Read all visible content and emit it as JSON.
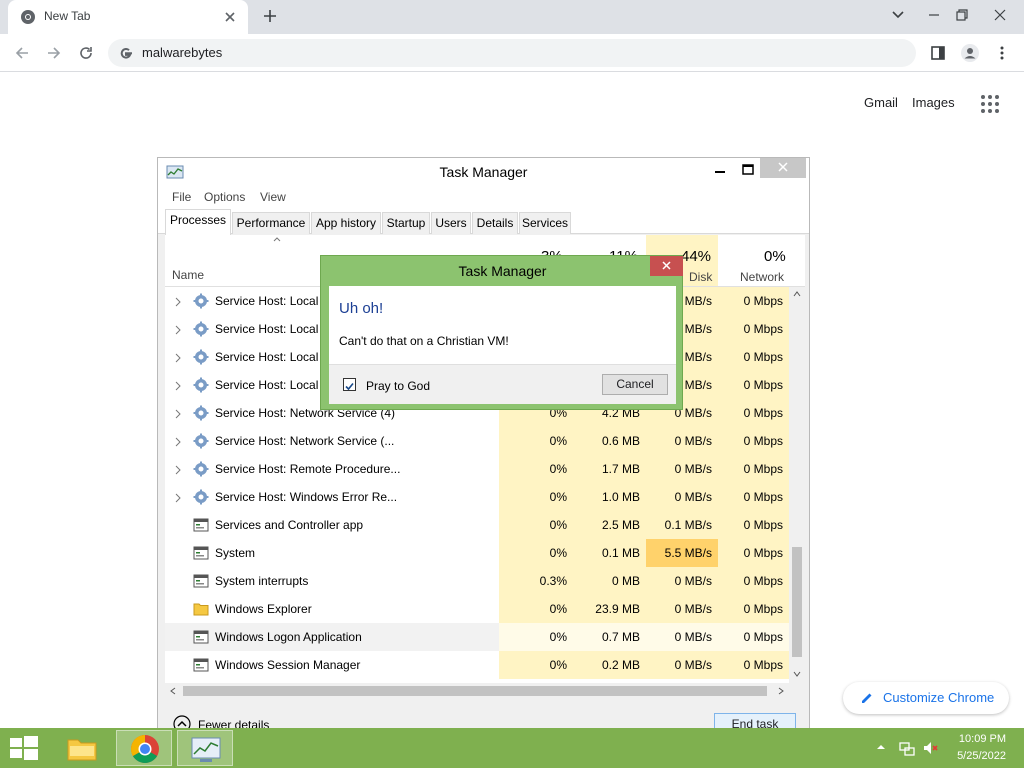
{
  "browser": {
    "tab_title": "New Tab",
    "url": "malwarebytes",
    "links": {
      "gmail": "Gmail",
      "images": "Images"
    },
    "customize_label": "Customize Chrome"
  },
  "task_manager": {
    "title": "Task Manager",
    "menu": [
      "File",
      "Options",
      "View"
    ],
    "tabs": [
      "Processes",
      "Performance",
      "App history",
      "Startup",
      "Users",
      "Details",
      "Services"
    ],
    "columns": {
      "name": "Name",
      "cpu_pct": "3%",
      "mem_pct": "11%",
      "disk_pct": "44%",
      "net_pct": "0%",
      "disk": "Disk",
      "network": "Network"
    },
    "rows": [
      {
        "name": "Service Host: Local S",
        "cpu": "",
        "mem": "",
        "disk": "MB/s",
        "net": "0 Mbps",
        "expandable": true,
        "icon": "gear"
      },
      {
        "name": "Service Host: Local S",
        "cpu": "",
        "mem": "",
        "disk": "MB/s",
        "net": "0 Mbps",
        "expandable": true,
        "icon": "gear"
      },
      {
        "name": "Service Host: Local S",
        "cpu": "",
        "mem": "",
        "disk": "MB/s",
        "net": "0 Mbps",
        "expandable": true,
        "icon": "gear"
      },
      {
        "name": "Service Host: Local S",
        "cpu": "",
        "mem": "",
        "disk": "MB/s",
        "net": "0 Mbps",
        "expandable": true,
        "icon": "gear"
      },
      {
        "name": "Service Host: Network Service (4)",
        "cpu": "0%",
        "mem": "4.2 MB",
        "disk": "0 MB/s",
        "net": "0 Mbps",
        "expandable": true,
        "icon": "gear"
      },
      {
        "name": "Service Host: Network Service (...",
        "cpu": "0%",
        "mem": "0.6 MB",
        "disk": "0 MB/s",
        "net": "0 Mbps",
        "expandable": true,
        "icon": "gear"
      },
      {
        "name": "Service Host: Remote Procedure...",
        "cpu": "0%",
        "mem": "1.7 MB",
        "disk": "0 MB/s",
        "net": "0 Mbps",
        "expandable": true,
        "icon": "gear"
      },
      {
        "name": "Service Host: Windows Error Re...",
        "cpu": "0%",
        "mem": "1.0 MB",
        "disk": "0 MB/s",
        "net": "0 Mbps",
        "expandable": true,
        "icon": "gear"
      },
      {
        "name": "Services and Controller app",
        "cpu": "0%",
        "mem": "2.5 MB",
        "disk": "0.1 MB/s",
        "net": "0 Mbps",
        "expandable": false,
        "icon": "window"
      },
      {
        "name": "System",
        "cpu": "0%",
        "mem": "0.1 MB",
        "disk": "5.5 MB/s",
        "net": "0 Mbps",
        "expandable": false,
        "icon": "window",
        "disk_highlight": true
      },
      {
        "name": "System interrupts",
        "cpu": "0.3%",
        "mem": "0 MB",
        "disk": "0 MB/s",
        "net": "0 Mbps",
        "expandable": false,
        "icon": "window"
      },
      {
        "name": "Windows Explorer",
        "cpu": "0%",
        "mem": "23.9 MB",
        "disk": "0 MB/s",
        "net": "0 Mbps",
        "expandable": false,
        "icon": "folder"
      },
      {
        "name": "Windows Logon Application",
        "cpu": "0%",
        "mem": "0.7 MB",
        "disk": "0 MB/s",
        "net": "0 Mbps",
        "expandable": false,
        "icon": "window",
        "selected": true
      },
      {
        "name": "Windows Session Manager",
        "cpu": "0%",
        "mem": "0.2 MB",
        "disk": "0 MB/s",
        "net": "0 Mbps",
        "expandable": false,
        "icon": "window"
      }
    ],
    "fewer_details": "Fewer details",
    "end_task": "End task"
  },
  "dialog": {
    "title": "Task Manager",
    "heading": "Uh oh!",
    "message": "Can't do that on a Christian VM!",
    "checkbox_label": "Pray to God",
    "checkbox_checked": true,
    "cancel_label": "Cancel"
  },
  "taskbar": {
    "time": "10:09 PM",
    "date": "5/25/2022"
  },
  "colors": {
    "cell_bg": "#fff4c4",
    "cell_hot": "#ffd26b",
    "taskbar": "#7fb04f",
    "dialog_frame": "#8cc36f"
  }
}
